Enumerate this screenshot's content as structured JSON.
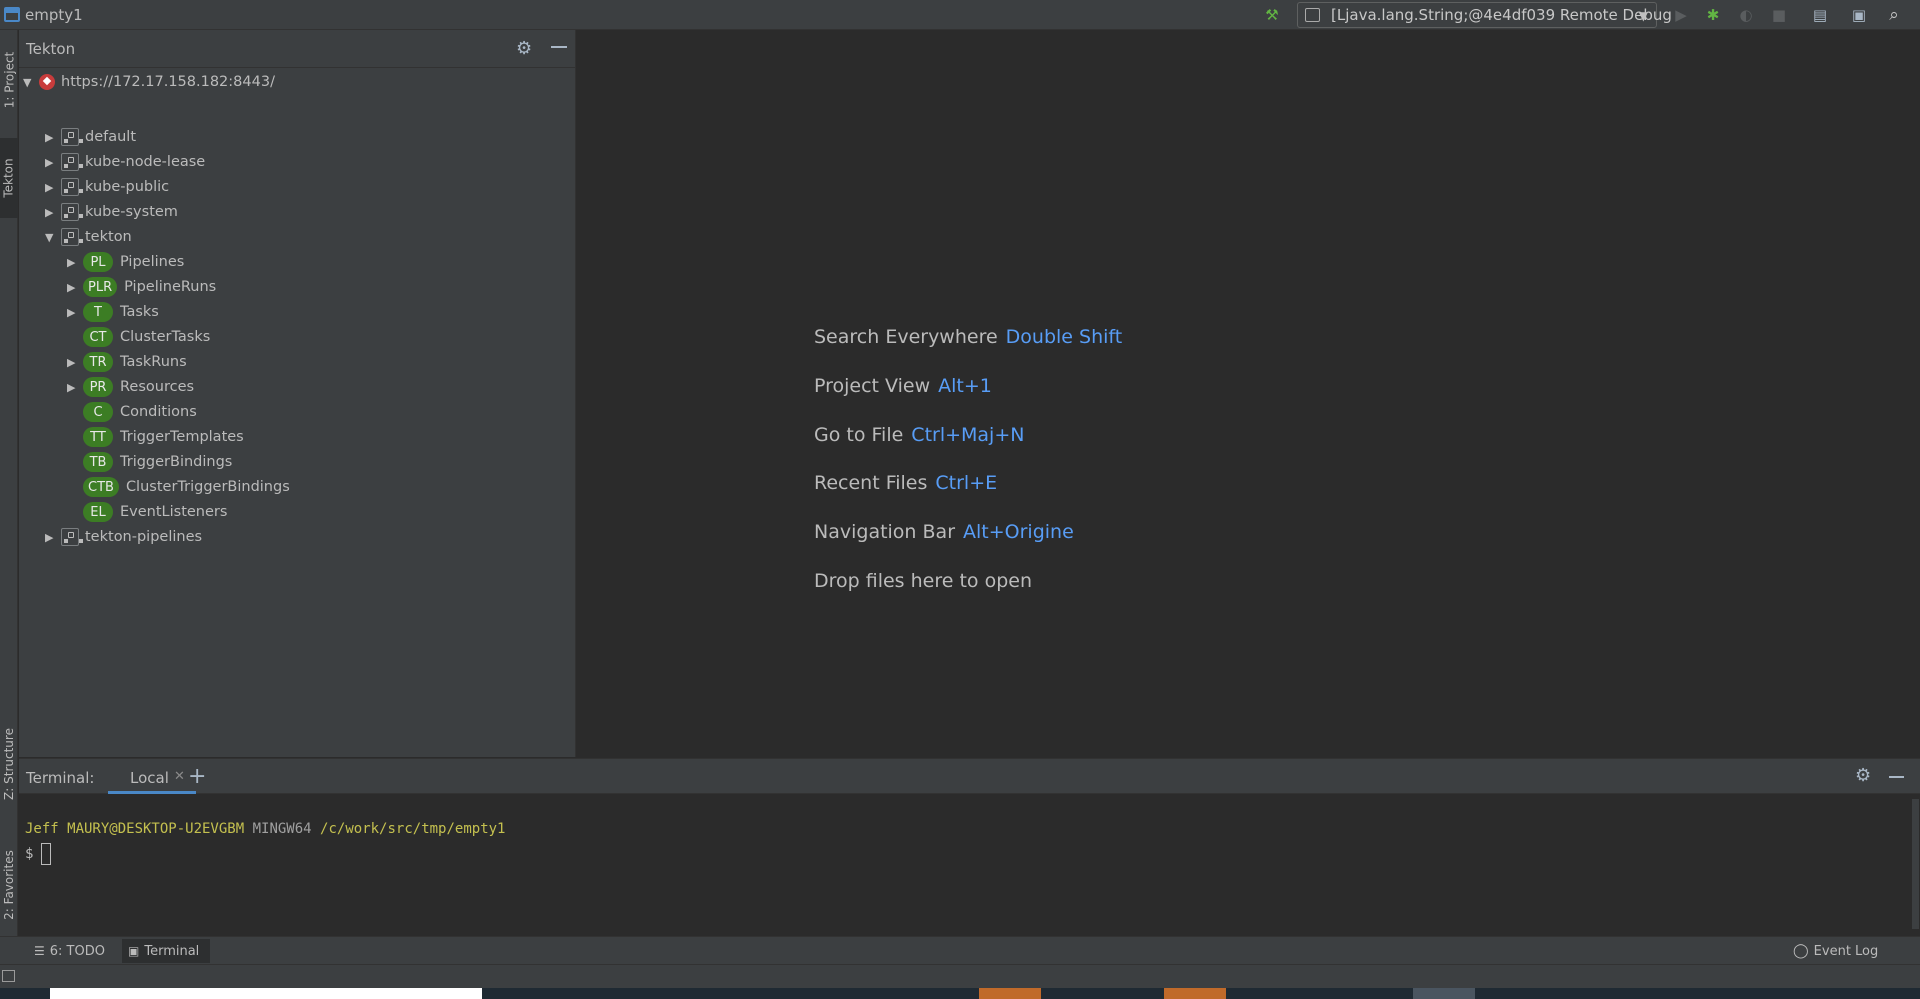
{
  "window": {
    "title": "empty1",
    "run_config": "[Ljava.lang.String;@4e4df039 Remote Debug"
  },
  "toolbar": {
    "icons": [
      "hammer-icon",
      "run-icon",
      "debug-icon",
      "coverage-icon",
      "stop-icon",
      "project-structure-icon",
      "terminal-window-icon",
      "search-icon"
    ]
  },
  "left_strip": {
    "tabs": [
      "1: Project",
      "Tekton",
      "Z: Structure",
      "2: Favorites"
    ]
  },
  "tekton_panel": {
    "title": "Tekton",
    "server": "https://172.17.158.182:8443/",
    "namespaces": [
      "default",
      "kube-node-lease",
      "kube-public",
      "kube-system",
      "tekton",
      "tekton-pipelines"
    ],
    "resources": [
      {
        "badge": "PL",
        "label": "Pipelines",
        "expandable": true
      },
      {
        "badge": "PLR",
        "label": "PipelineRuns",
        "expandable": true
      },
      {
        "badge": "T",
        "label": "Tasks",
        "expandable": true
      },
      {
        "badge": "CT",
        "label": "ClusterTasks",
        "expandable": false
      },
      {
        "badge": "TR",
        "label": "TaskRuns",
        "expandable": true
      },
      {
        "badge": "PR",
        "label": "Resources",
        "expandable": true
      },
      {
        "badge": "C",
        "label": "Conditions",
        "expandable": false
      },
      {
        "badge": "TT",
        "label": "TriggerTemplates",
        "expandable": false
      },
      {
        "badge": "TB",
        "label": "TriggerBindings",
        "expandable": false
      },
      {
        "badge": "CTB",
        "label": "ClusterTriggerBindings",
        "expandable": false
      },
      {
        "badge": "EL",
        "label": "EventListeners",
        "expandable": false
      }
    ]
  },
  "editor": {
    "hints": [
      {
        "label": "Search Everywhere",
        "key": "Double Shift"
      },
      {
        "label": "Project View",
        "key": "Alt+1"
      },
      {
        "label": "Go to File",
        "key": "Ctrl+Maj+N"
      },
      {
        "label": "Recent Files",
        "key": "Ctrl+E"
      },
      {
        "label": "Navigation Bar",
        "key": "Alt+Origine"
      },
      {
        "label": "Drop files here to open",
        "key": ""
      }
    ]
  },
  "terminal": {
    "label": "Terminal:",
    "tab": "Local",
    "prompt_user": "Jeff MAURY@DESKTOP-U2EVGBM",
    "prompt_sys": "MINGW64",
    "prompt_path": "/c/work/src/tmp/empty1",
    "prompt_symbol": "$"
  },
  "bottom_bar": {
    "todo": "6: TODO",
    "terminal": "Terminal",
    "event_log": "Event Log"
  },
  "colors": {
    "panel_bg": "#3c3f41",
    "editor_bg": "#2b2b2b",
    "badge_green": "#3c7d24",
    "link_blue": "#589df6",
    "prompt_yellow": "#c4c04f"
  }
}
